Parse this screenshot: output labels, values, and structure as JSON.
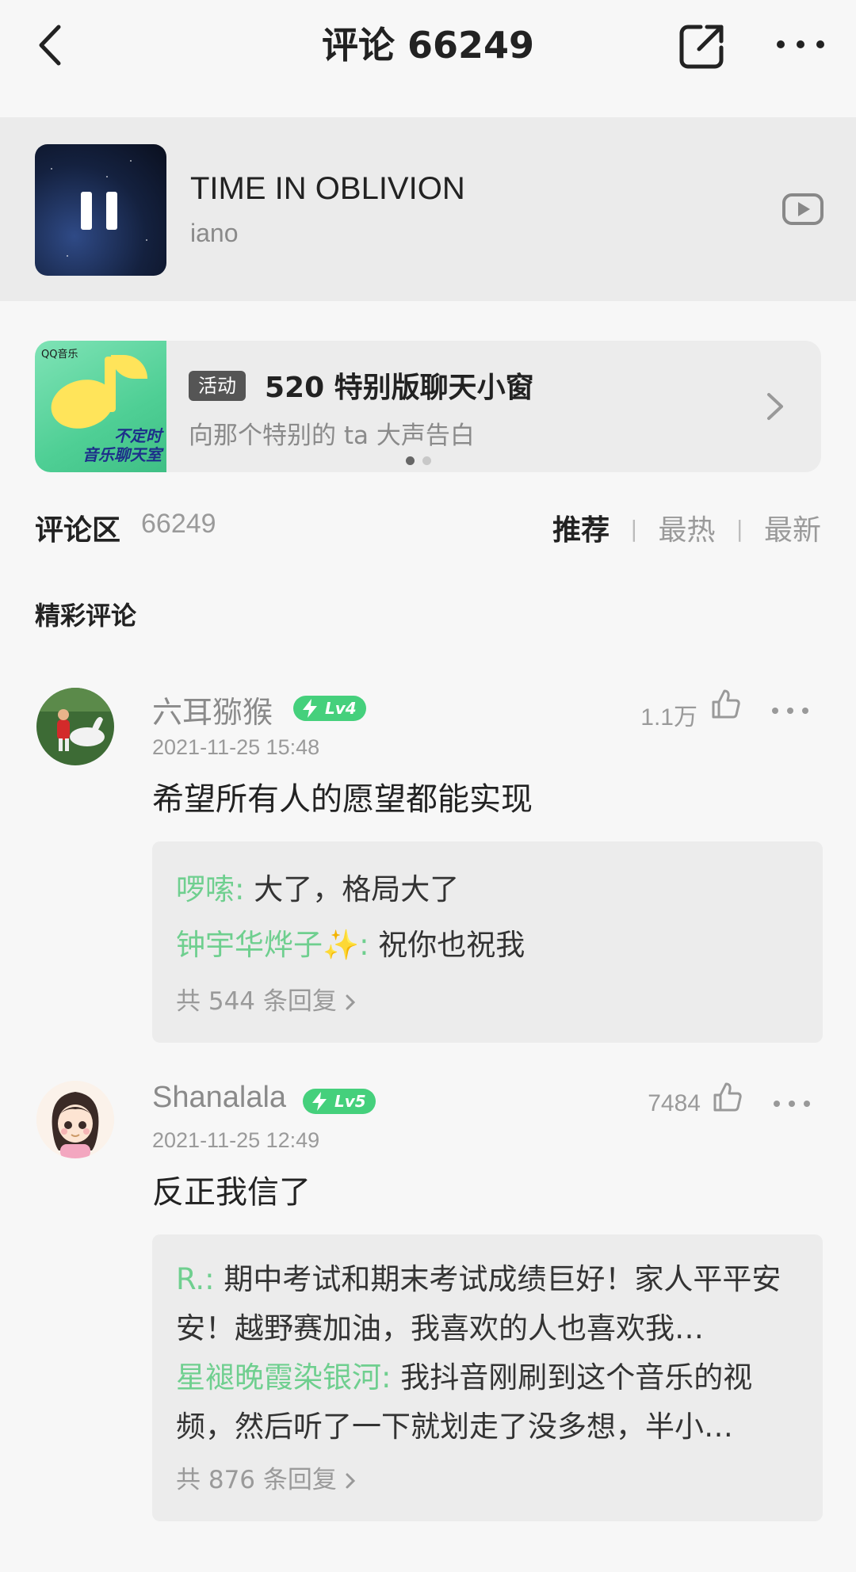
{
  "header": {
    "title": "评论 66249",
    "icons": {
      "back": "back-chevron-icon",
      "share": "share-external-icon",
      "more": "more-dots-icon"
    }
  },
  "now_playing": {
    "title": "TIME IN OBLIVION",
    "artist": "iano",
    "state": "playing",
    "icons": {
      "pause": "pause-icon",
      "video": "video-play-icon"
    }
  },
  "activity_banner": {
    "image_brand": "QQ音乐",
    "image_caption_line1": "不定时",
    "image_caption_line2": "音乐聊天室",
    "tag": "活动",
    "title": "520 特别版聊天小窗",
    "subtitle": "向那个特别的 ta 大声告白",
    "page_count": 2,
    "active_page": 1
  },
  "comment_section": {
    "title": "评论区",
    "count": "66249",
    "sort_options": [
      "推荐",
      "最热",
      "最新"
    ],
    "active_sort": "推荐",
    "featured_heading": "精彩评论"
  },
  "comments": [
    {
      "username": "六耳猕猴",
      "level": "Lv4",
      "time": "2021-11-25 15:48",
      "likes": "1.1万",
      "text": "希望所有人的愿望都能实现",
      "replies": [
        {
          "name": "啰嗦:",
          "text": " 大了，格局大了"
        },
        {
          "name": "钟宇华烨子✨:",
          "text": " 祝你也祝我"
        }
      ],
      "reply_total": "共 544 条回复"
    },
    {
      "username": "Shanalala",
      "level": "Lv5",
      "time": "2021-11-25 12:49",
      "likes": "7484",
      "text": "反正我信了",
      "replies": [
        {
          "name": "R.:",
          "text": " 期中考试和期末考试成绩巨好！家人平平安安！越野赛加油，我喜欢的人也喜欢我…"
        },
        {
          "name": "星褪晚霞染银河:",
          "text": " 我抖音刚刷到这个音乐的视频，然后听了一下就划走了没多想，半小…"
        }
      ],
      "reply_total": "共 876 条回复"
    }
  ],
  "colors": {
    "background": "#f7f7f7",
    "level_badge": "#45d07c",
    "reply_name": "#6fcf8f",
    "secondary_text": "#9a9a9a"
  }
}
